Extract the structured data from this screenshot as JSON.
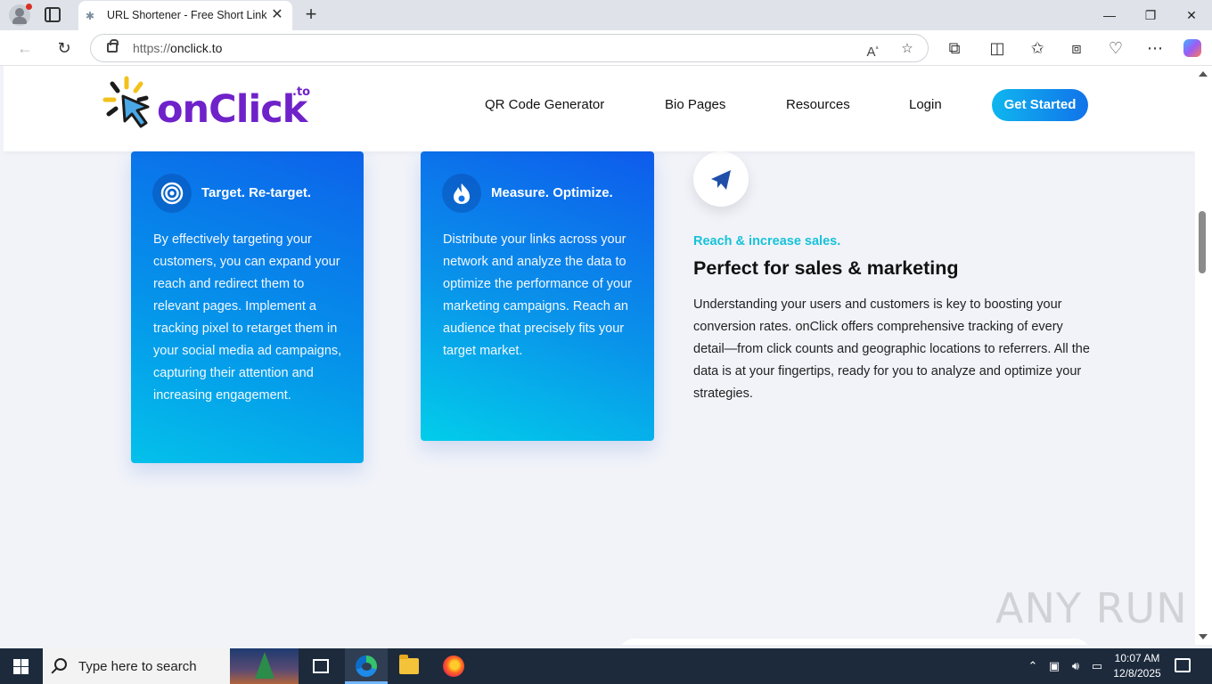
{
  "browser": {
    "tab_title": "URL Shortener - Free Short Link &",
    "url_protocol": "https://",
    "url_host": "onclick.to"
  },
  "header": {
    "logo_text": "onClick",
    "logo_suffix": ".to",
    "nav": [
      "QR Code Generator",
      "Bio Pages",
      "Resources",
      "Login"
    ],
    "cta_label": "Get Started"
  },
  "cards": [
    {
      "title": "Target. Re-target.",
      "text": "By effectively targeting your customers, you can expand your reach and redirect them to relevant pages. Implement a tracking pixel to retarget them in your social media ad campaigns, capturing their attention and increasing engagement."
    },
    {
      "title": "Measure. Optimize.",
      "text": "Distribute your links across your network and analyze the data to optimize the performance of your marketing campaigns. Reach an audience that precisely fits your target market."
    }
  ],
  "feature": {
    "kicker": "Reach & increase sales.",
    "title": "Perfect for sales & marketing",
    "text": "Understanding your users and customers is key to boosting your conversion rates. onClick offers comprehensive tracking of every detail—from click counts and geographic locations to referrers. All the data is at your fingertips, ready for you to analyze and optimize your strategies."
  },
  "watermark": "ANY RUN",
  "taskbar": {
    "search_placeholder": "Type here to search",
    "time": "10:07 AM",
    "date": "12/8/2025"
  },
  "colors": {
    "brand_purple": "#6f22c9",
    "accent_cyan": "#17c2d8",
    "cta_blue": "#1173ea"
  }
}
